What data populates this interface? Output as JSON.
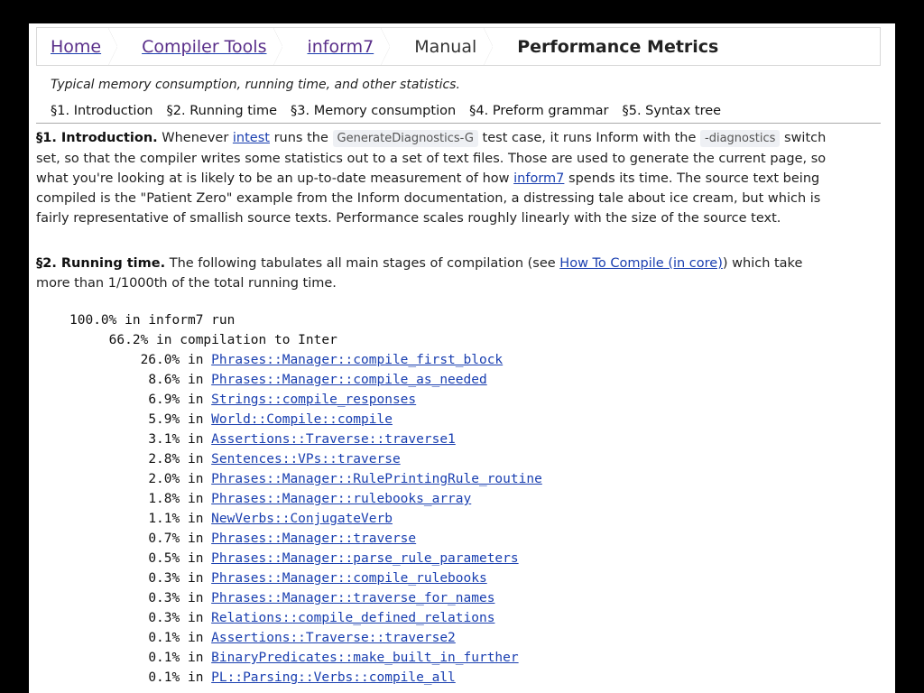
{
  "breadcrumb": [
    "Home",
    "Compiler Tools",
    "inform7",
    "Manual",
    "Performance Metrics"
  ],
  "purpose": "Typical memory consumption, running time, and other statistics.",
  "toc": [
    "§1. Introduction",
    "§2. Running time",
    "§3. Memory consumption",
    "§4. Preform grammar",
    "§5. Syntax tree"
  ],
  "s1": {
    "heading": "§1. Introduction.",
    "t1": " Whenever ",
    "intest": "intest",
    "t2": " runs the ",
    "testcase": "GenerateDiagnostics-G",
    "t3": " test case, it runs Inform with the ",
    "switch": "-diagnostics",
    "t4": " switch set, so that the compiler writes some statistics out to a set of text files. Those are used to generate the current page, so what you're looking at is likely to be an up-to-date measurement of how ",
    "inform7": "inform7",
    "t5": " spends its time. The source text being compiled is the \"Patient Zero\" example from the Inform documentation, a distressing tale about ice cream, but which is fairly representative of smallish source texts. Performance scales roughly linearly with the size of the source text."
  },
  "s2": {
    "heading": "§2. Running time.",
    "t1": " The following tabulates all main stages of compilation (see ",
    "howto": "How To Compile (in core)",
    "t2": ") which take more than 1/1000th of the total running time."
  },
  "timings": [
    {
      "pct": "100.0%",
      "label": "in inform7 run",
      "link": false,
      "indent": 0
    },
    {
      "pct": "66.2%",
      "label": "in compilation to Inter",
      "link": false,
      "indent": 1
    },
    {
      "pct": "26.0%",
      "label": "Phrases::Manager::compile_first_block",
      "link": true,
      "indent": 2
    },
    {
      "pct": "8.6%",
      "label": "Phrases::Manager::compile_as_needed",
      "link": true,
      "indent": 2
    },
    {
      "pct": "6.9%",
      "label": "Strings::compile_responses",
      "link": true,
      "indent": 2
    },
    {
      "pct": "5.9%",
      "label": "World::Compile::compile",
      "link": true,
      "indent": 2
    },
    {
      "pct": "3.1%",
      "label": "Assertions::Traverse::traverse1",
      "link": true,
      "indent": 2
    },
    {
      "pct": "2.8%",
      "label": "Sentences::VPs::traverse",
      "link": true,
      "indent": 2
    },
    {
      "pct": "2.0%",
      "label": "Phrases::Manager::RulePrintingRule_routine",
      "link": true,
      "indent": 2
    },
    {
      "pct": "1.8%",
      "label": "Phrases::Manager::rulebooks_array",
      "link": true,
      "indent": 2
    },
    {
      "pct": "1.1%",
      "label": "NewVerbs::ConjugateVerb",
      "link": true,
      "indent": 2
    },
    {
      "pct": "0.7%",
      "label": "Phrases::Manager::traverse",
      "link": true,
      "indent": 2
    },
    {
      "pct": "0.5%",
      "label": "Phrases::Manager::parse_rule_parameters",
      "link": true,
      "indent": 2
    },
    {
      "pct": "0.3%",
      "label": "Phrases::Manager::compile_rulebooks",
      "link": true,
      "indent": 2
    },
    {
      "pct": "0.3%",
      "label": "Phrases::Manager::traverse_for_names",
      "link": true,
      "indent": 2
    },
    {
      "pct": "0.3%",
      "label": "Relations::compile_defined_relations",
      "link": true,
      "indent": 2
    },
    {
      "pct": "0.1%",
      "label": "Assertions::Traverse::traverse2",
      "link": true,
      "indent": 2
    },
    {
      "pct": "0.1%",
      "label": "BinaryPredicates::make_built_in_further",
      "link": true,
      "indent": 2
    },
    {
      "pct": "0.1%",
      "label": "PL::Parsing::Verbs::compile_all",
      "link": true,
      "indent": 2
    }
  ]
}
